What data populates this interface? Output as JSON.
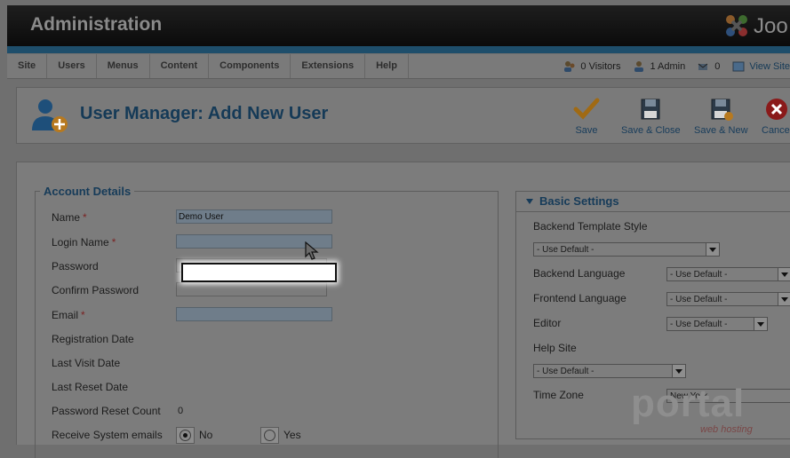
{
  "header": {
    "title": "Administration",
    "logo_text": "Joo"
  },
  "menu": [
    "Site",
    "Users",
    "Menus",
    "Content",
    "Components",
    "Extensions",
    "Help"
  ],
  "status": {
    "visitors": "0 Visitors",
    "admins": "1 Admin",
    "messages": "0",
    "view_site": "View Site"
  },
  "page": {
    "title": "User Manager: Add New User"
  },
  "toolbar": {
    "save": "Save",
    "save_close": "Save & Close",
    "save_new": "Save & New",
    "cancel": "Cancel"
  },
  "account": {
    "legend": "Account Details",
    "name_label": "Name",
    "name_value": "Demo User",
    "login_label": "Login Name",
    "login_value": "",
    "password_label": "Password",
    "confirm_label": "Confirm Password",
    "email_label": "Email",
    "email_value": "",
    "registration_label": "Registration Date",
    "last_visit_label": "Last Visit Date",
    "last_reset_label": "Last Reset Date",
    "reset_count_label": "Password Reset Count",
    "reset_count_value": "0",
    "receive_label": "Receive System emails",
    "no_label": "No",
    "yes_label": "Yes",
    "required_mark": "*"
  },
  "basic": {
    "title": "Basic Settings",
    "backend_template_label": "Backend Template Style",
    "backend_template_value": "- Use Default -",
    "backend_lang_label": "Backend Language",
    "backend_lang_value": "- Use Default -",
    "frontend_lang_label": "Frontend Language",
    "frontend_lang_value": "- Use Default -",
    "editor_label": "Editor",
    "editor_value": "- Use Default -",
    "help_label": "Help Site",
    "help_value": "- Use Default -",
    "timezone_label": "Time Zone",
    "timezone_value": "New York"
  },
  "watermark": {
    "text": "portal",
    "sub": "web hosting"
  },
  "colors": {
    "heading": "#163b59",
    "header_bar": "#1e4e6b",
    "required": "#7a2424"
  }
}
